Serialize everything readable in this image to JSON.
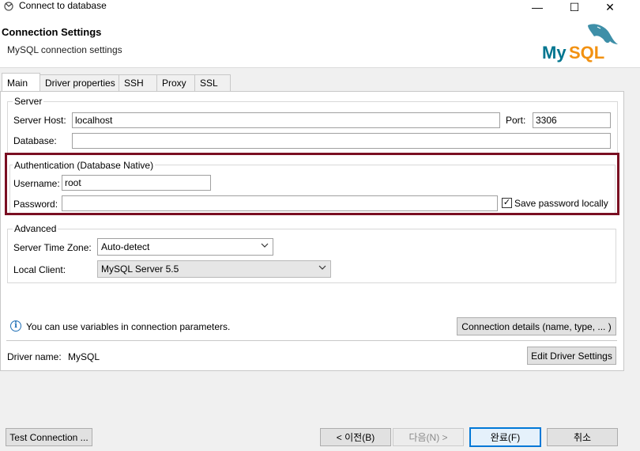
{
  "window": {
    "title": "Connect to database",
    "minimize": "—",
    "maximize": "☐",
    "close": "✕"
  },
  "header": {
    "title": "Connection Settings",
    "subtitle": "MySQL connection settings",
    "logo_text": "MySQL"
  },
  "tabs": [
    {
      "label": "Main",
      "active": true
    },
    {
      "label": "Driver properties"
    },
    {
      "label": "SSH"
    },
    {
      "label": "Proxy"
    },
    {
      "label": "SSL"
    }
  ],
  "server": {
    "legend": "Server",
    "host_label": "Server Host:",
    "host_value": "localhost",
    "port_label": "Port:",
    "port_value": "3306",
    "database_label": "Database:",
    "database_value": ""
  },
  "auth": {
    "legend": "Authentication (Database Native)",
    "username_label": "Username:",
    "username_value": "root",
    "password_label": "Password:",
    "password_value": "",
    "save_password_label": "Save password locally",
    "save_password_checked": "✓",
    "highlight_color": "#7a0f22"
  },
  "advanced": {
    "legend": "Advanced",
    "timezone_label": "Server Time Zone:",
    "timezone_value": "Auto-detect",
    "local_client_label": "Local Client:",
    "local_client_value": "MySQL Server 5.5"
  },
  "info": {
    "text": "You can use variables in connection parameters.",
    "details_button": "Connection details (name, type, ... )"
  },
  "driver": {
    "label": "Driver name:",
    "value": "MySQL",
    "edit_button": "Edit Driver Settings"
  },
  "footer": {
    "test_button": "Test Connection ...",
    "back_button": "< 이전(B)",
    "next_button": "다음(N) >",
    "finish_button": "완료(F)",
    "cancel_button": "취소"
  }
}
